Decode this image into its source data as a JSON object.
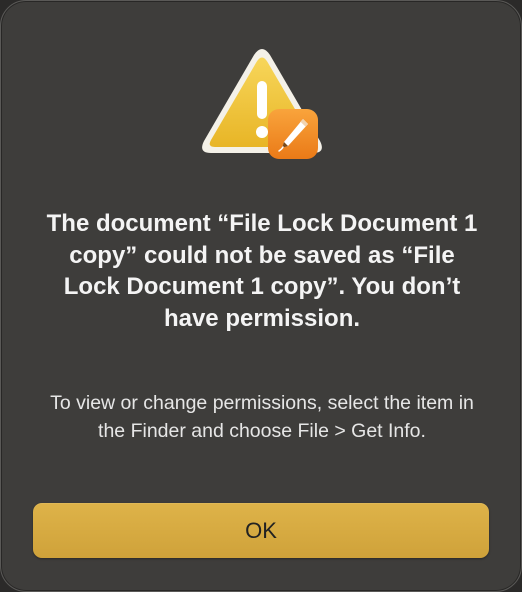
{
  "dialog": {
    "icon": "warning-triangle-icon",
    "badge_icon": "pages-app-icon",
    "title": "The document “File Lock Document 1 copy” could not be saved as “File Lock Document 1 copy”. You don’t have permission.",
    "message": "To view or change permissions, select the item in the Finder and choose File > Get Info.",
    "ok_label": "OK",
    "colors": {
      "background": "#3e3d3b",
      "button": "#d6aa40",
      "warning": "#f2c53d",
      "badge": "#f08a24"
    }
  }
}
